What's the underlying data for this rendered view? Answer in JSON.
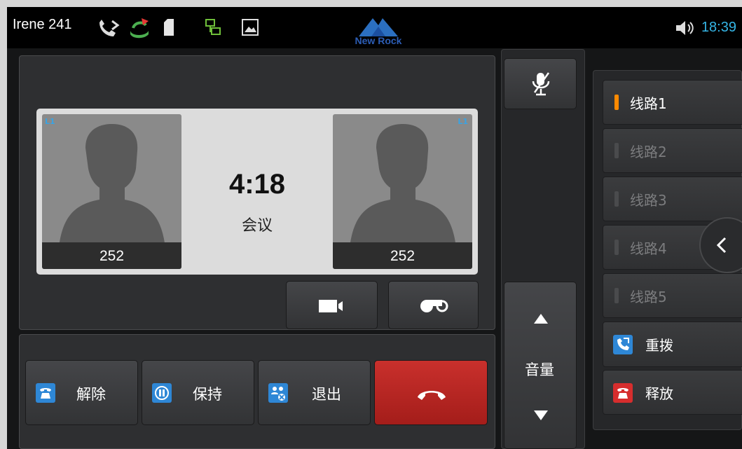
{
  "status_bar": {
    "user": "Irene 241",
    "logo_text": "New Rock",
    "time": "18:39"
  },
  "call": {
    "timer": "4:18",
    "state": "会议",
    "participants": [
      {
        "line_tag": "L1",
        "name": "252"
      },
      {
        "line_tag": "L1",
        "name": "252"
      }
    ]
  },
  "actions": {
    "unmute": "解除",
    "hold": "保持",
    "exit": "退出"
  },
  "controls": {
    "volume": "音量"
  },
  "lines": [
    {
      "label": "线路1",
      "active": true
    },
    {
      "label": "线路2",
      "active": false
    },
    {
      "label": "线路3",
      "active": false
    },
    {
      "label": "线路4",
      "active": false
    },
    {
      "label": "线路5",
      "active": false
    }
  ],
  "side_actions": {
    "redial": "重拨",
    "release": "释放"
  },
  "colors": {
    "accent": "#35b5e5",
    "active_line": "#ff8a00",
    "hangup": "#c0282b"
  }
}
